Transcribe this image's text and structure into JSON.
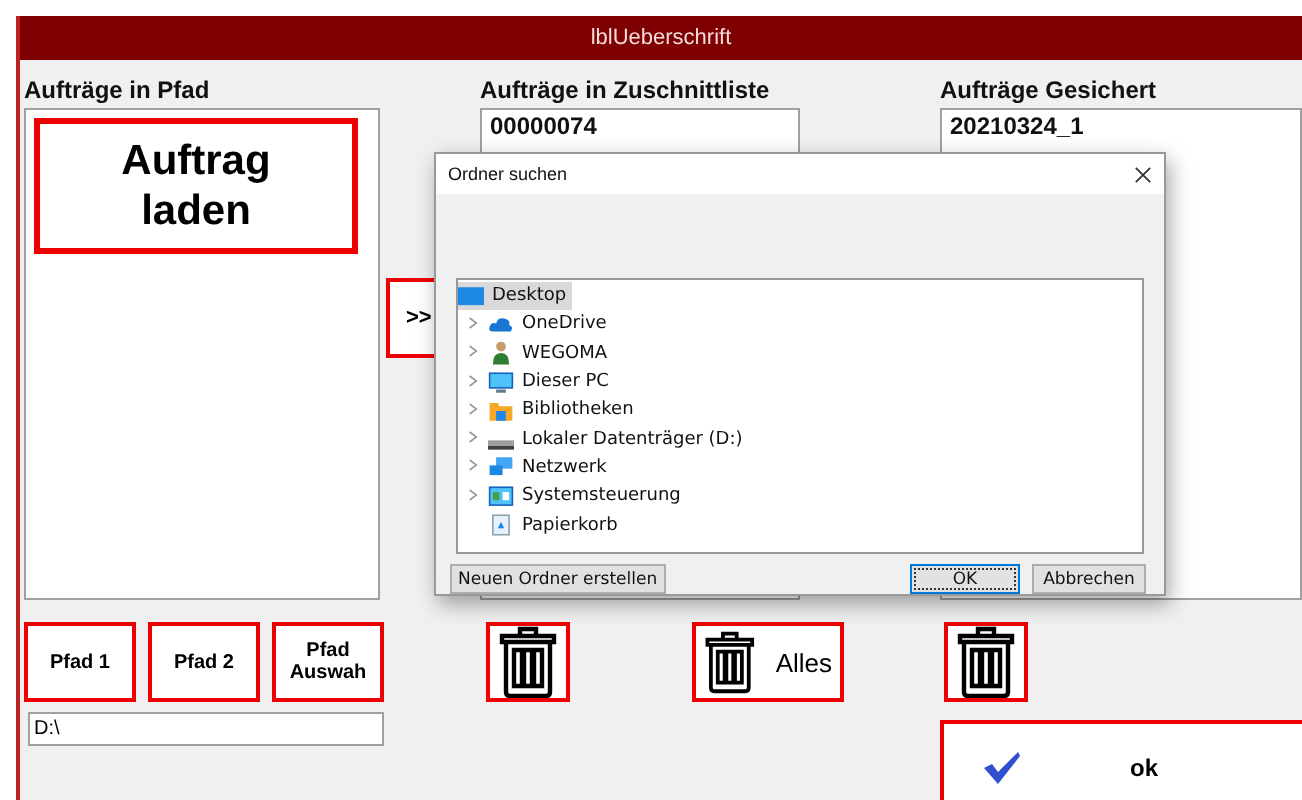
{
  "window": {
    "title": "lblUeberschrift"
  },
  "left_panel": {
    "label": "Aufträge in Pfad",
    "load_button": "Auftrag laden"
  },
  "transfer_button": ">>",
  "middle_panel": {
    "label": "Aufträge in Zuschnittliste",
    "items": [
      "00000074"
    ]
  },
  "right_panel": {
    "label": "Aufträge Gesichert",
    "items": [
      "20210324_1"
    ]
  },
  "path_buttons": [
    "Pfad 1",
    "Pfad 2",
    "Pfad Auswah"
  ],
  "delete_buttons": [
    {
      "kind": "icon"
    },
    {
      "kind": "icon_text",
      "label": "Alles"
    },
    {
      "kind": "icon"
    }
  ],
  "path_field": {
    "value": "D:\\"
  },
  "ok_button": {
    "label": "ok"
  },
  "dialog": {
    "title": "Ordner suchen",
    "tree": {
      "label": "Desktop",
      "kind": "desktop",
      "selected": true,
      "children": [
        {
          "label": "OneDrive",
          "kind": "cloud",
          "selected": false,
          "expandable": true
        },
        {
          "label": "WEGOMA",
          "kind": "user",
          "selected": false,
          "expandable": true
        },
        {
          "label": "Dieser PC",
          "kind": "monitor",
          "selected": false,
          "expandable": true
        },
        {
          "label": "Bibliotheken",
          "kind": "folder",
          "selected": false,
          "expandable": true
        },
        {
          "label": "Lokaler Datenträger (D:)",
          "kind": "drive",
          "selected": false,
          "expandable": true
        },
        {
          "label": "Netzwerk",
          "kind": "network",
          "selected": false,
          "expandable": true
        },
        {
          "label": "Systemsteuerung",
          "kind": "panel",
          "selected": false,
          "expandable": true
        },
        {
          "label": "Papierkorb",
          "kind": "bin",
          "selected": false,
          "expandable": false
        }
      ]
    },
    "buttons": [
      {
        "label": "Neuen Ordner erstellen",
        "default": false
      },
      {
        "label": "OK",
        "default": true
      },
      {
        "label": "Abbrechen",
        "default": false
      }
    ]
  }
}
